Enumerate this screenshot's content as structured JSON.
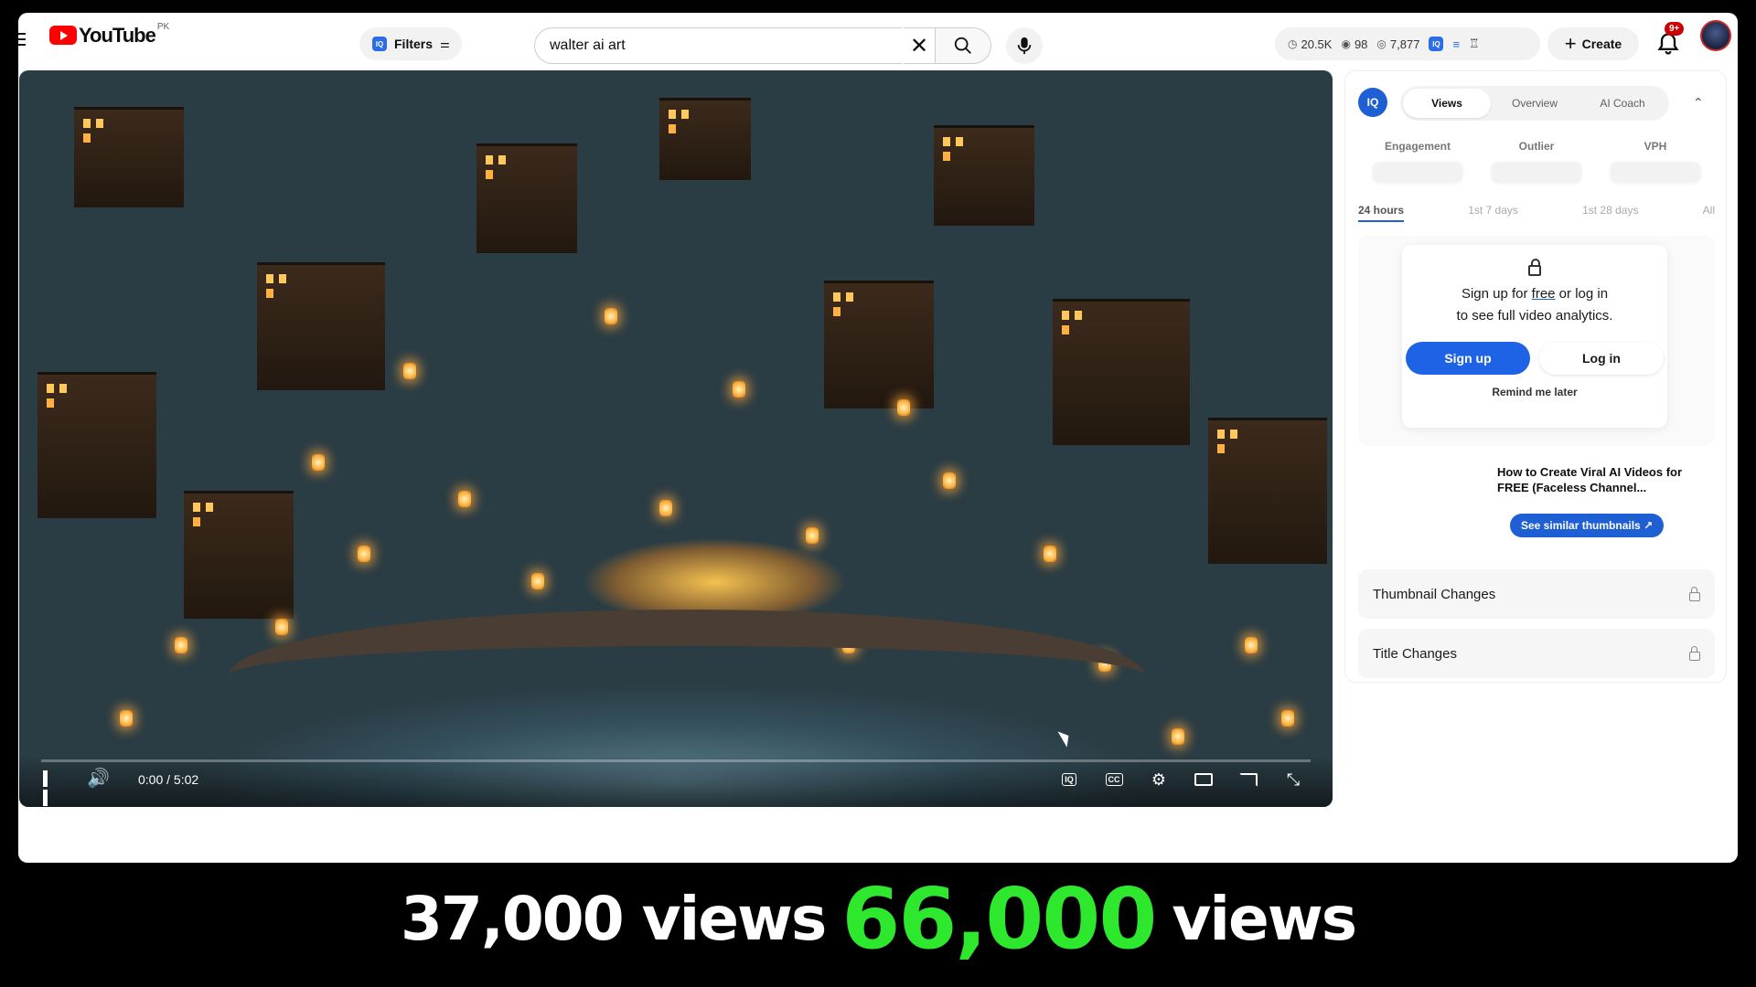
{
  "header": {
    "logo_text": "YouTube",
    "region": "PK",
    "filters_label": "Filters",
    "search_value": "walter ai art",
    "stats": {
      "subs": "20.5K",
      "videos": "98",
      "views": "7,877"
    },
    "create_label": "Create",
    "notifications_badge": "9+"
  },
  "player": {
    "time": "0:00 / 5:02"
  },
  "panel": {
    "logo": "IQ",
    "tabs": [
      "Views",
      "Overview",
      "AI Coach"
    ],
    "active_tab": "Views",
    "metrics": [
      "Engagement",
      "Outlier",
      "VPH"
    ],
    "ranges": [
      "24 hours",
      "1st 7 days",
      "1st 28 days",
      "All"
    ],
    "lock_line1_a": "Sign up for ",
    "lock_line1_free": "free",
    "lock_line1_b": " or log in",
    "lock_line2": "to see full video analytics.",
    "signup_label": "Sign up",
    "login_label": "Log in",
    "remind_label": "Remind me later",
    "video_title": "How to Create Viral AI Videos for FREE (Faceless Channel...",
    "similar_label": "See similar thumbnails",
    "row1": "Thumbnail Changes",
    "row2": "Title Changes"
  },
  "caption": {
    "part1": "37,000 views",
    "part2": "66,000",
    "part3": "views"
  }
}
